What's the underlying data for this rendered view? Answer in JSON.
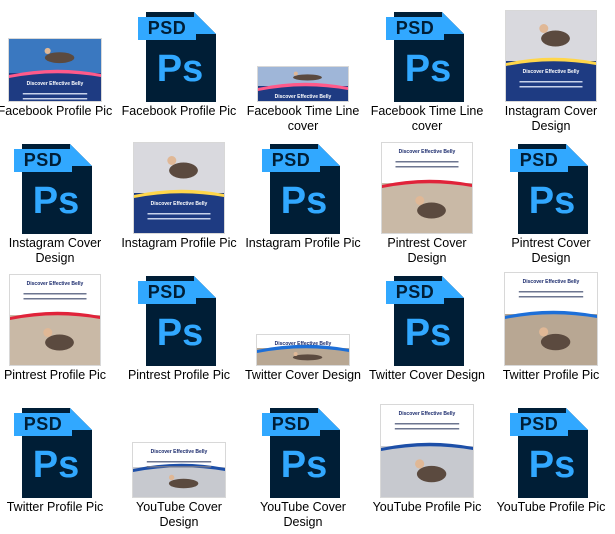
{
  "files": [
    {
      "label": "Facebook Profile Pic",
      "kind": "image",
      "variant": "fb-profile"
    },
    {
      "label": "Facebook Profile Pic",
      "kind": "psd"
    },
    {
      "label": "Facebook Time Line cover",
      "kind": "image",
      "variant": "fb-cover"
    },
    {
      "label": "Facebook Time Line cover",
      "kind": "psd"
    },
    {
      "label": "Instagram Cover Design",
      "kind": "image",
      "variant": "ig-cover"
    },
    {
      "label": "Instagram Cover Design",
      "kind": "psd"
    },
    {
      "label": "Instagram Profile Pic",
      "kind": "image",
      "variant": "ig-profile"
    },
    {
      "label": "Instagram Profile Pic",
      "kind": "psd"
    },
    {
      "label": "Pintrest Cover Design",
      "kind": "image",
      "variant": "pin-cover"
    },
    {
      "label": "Pintrest Cover Design",
      "kind": "psd"
    },
    {
      "label": "Pintrest Profile Pic",
      "kind": "image",
      "variant": "pin-profile"
    },
    {
      "label": "Pintrest Profile Pic",
      "kind": "psd"
    },
    {
      "label": "Twitter Cover Design",
      "kind": "image",
      "variant": "tw-cover"
    },
    {
      "label": "Twitter Cover Design",
      "kind": "psd"
    },
    {
      "label": "Twitter Profile Pic",
      "kind": "image",
      "variant": "tw-profile"
    },
    {
      "label": "Twitter Profile Pic",
      "kind": "psd"
    },
    {
      "label": "YouTube Cover Design",
      "kind": "image",
      "variant": "yt-cover"
    },
    {
      "label": "YouTube Cover Design",
      "kind": "psd"
    },
    {
      "label": "YouTube Profile Pic",
      "kind": "image",
      "variant": "yt-profile"
    },
    {
      "label": "YouTube Profile Pic",
      "kind": "psd"
    }
  ],
  "psd_icon": {
    "tag": "PSD",
    "glyph": "Ps",
    "body_color": "#001e36",
    "accent_color": "#31a8ff"
  },
  "thumbnail_caption": {
    "headline": "Discover Effective Belly"
  }
}
